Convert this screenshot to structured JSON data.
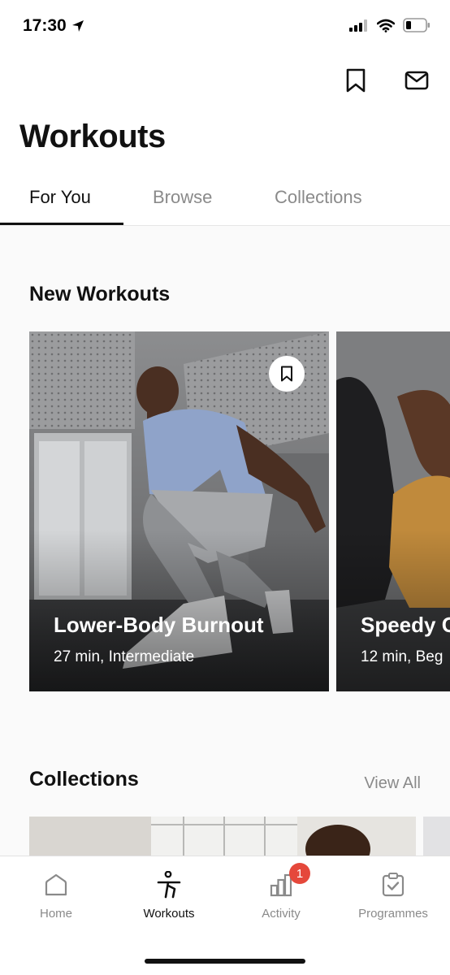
{
  "status_bar": {
    "time": "17:30"
  },
  "header": {
    "title": "Workouts"
  },
  "tabs": [
    {
      "label": "For You"
    },
    {
      "label": "Browse"
    },
    {
      "label": "Collections"
    }
  ],
  "new_workouts": {
    "title": "New Workouts",
    "cards": [
      {
        "title": "Lower-Body Burnout",
        "subtitle": "27 min, Intermediate"
      },
      {
        "title": "Speedy C",
        "subtitle": "12 min, Beg"
      }
    ]
  },
  "collections": {
    "title": "Collections",
    "view_all": "View All"
  },
  "tabbar": {
    "items": [
      {
        "label": "Home",
        "icon": "house-icon"
      },
      {
        "label": "Workouts",
        "icon": "runner-icon"
      },
      {
        "label": "Activity",
        "icon": "bar-chart-icon",
        "badge": "1"
      },
      {
        "label": "Programmes",
        "icon": "clipboard-check-icon"
      }
    ]
  },
  "colors": {
    "badge": "#e5483b",
    "active_text": "#111111",
    "inactive_text": "#8a8a8a"
  }
}
